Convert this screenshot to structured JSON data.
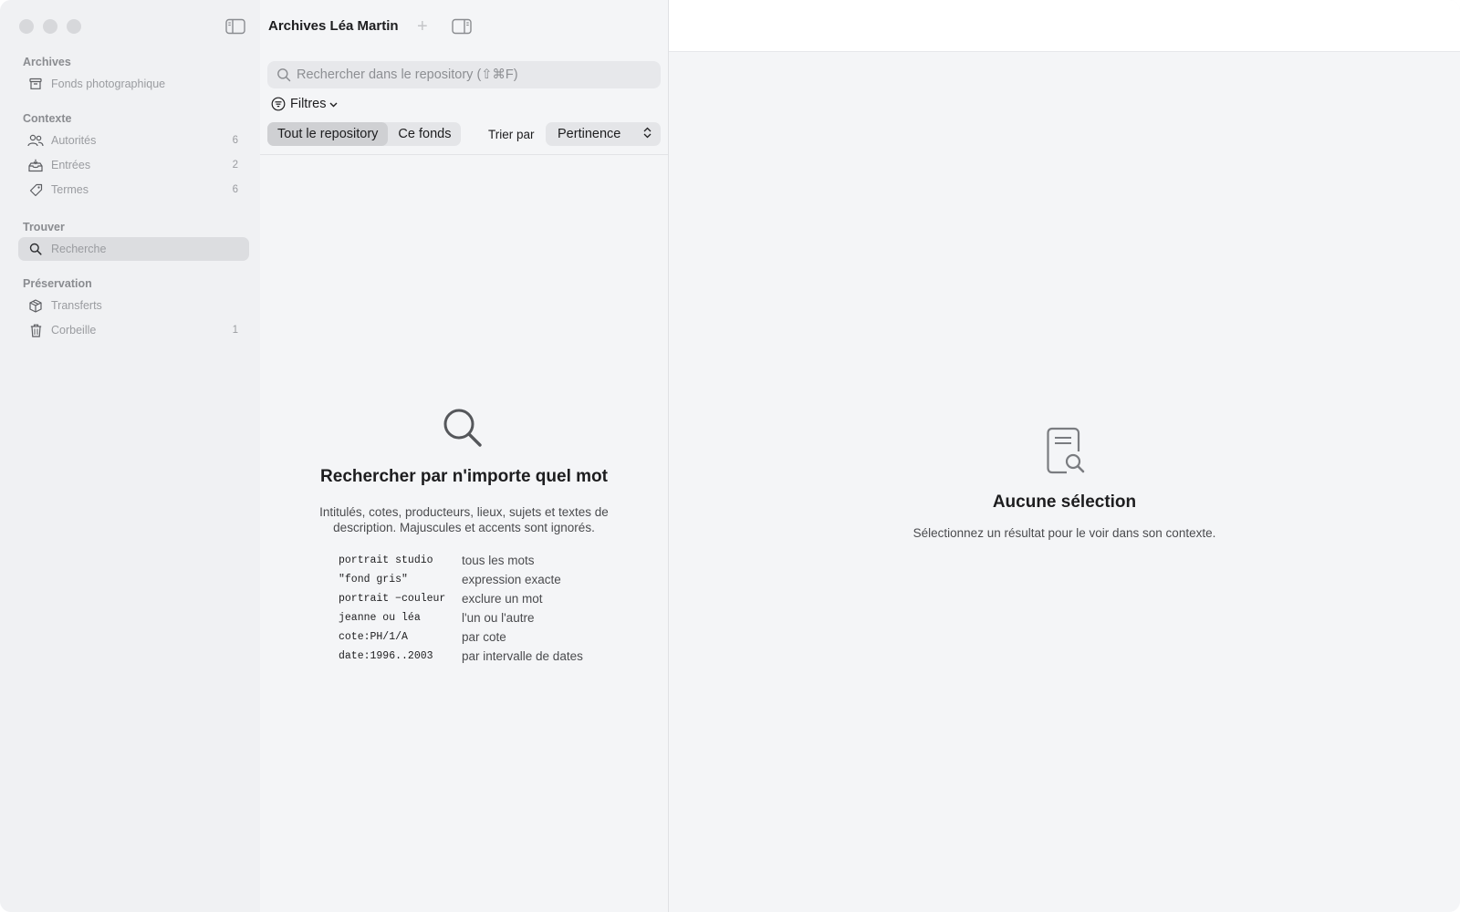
{
  "sidebar": {
    "sections": [
      {
        "title": "Archives",
        "items": [
          {
            "label": "Fonds photographique",
            "count": "",
            "icon": "archive-box-icon"
          }
        ]
      },
      {
        "title": "Contexte",
        "items": [
          {
            "label": "Autorités",
            "count": "6",
            "icon": "people-icon"
          },
          {
            "label": "Entrées",
            "count": "2",
            "icon": "tray-icon"
          },
          {
            "label": "Termes",
            "count": "6",
            "icon": "tag-icon"
          }
        ]
      },
      {
        "title": "Trouver",
        "items": [
          {
            "label": "Recherche",
            "count": "",
            "icon": "search-icon"
          }
        ]
      },
      {
        "title": "Préservation",
        "items": [
          {
            "label": "Transferts",
            "count": "",
            "icon": "package-icon"
          },
          {
            "label": "Corbeille",
            "count": "1",
            "icon": "trash-icon"
          }
        ]
      }
    ]
  },
  "header": {
    "title": "Archives Léa Martin"
  },
  "search": {
    "placeholder": "Rechercher dans le repository (⇧⌘F)",
    "value": ""
  },
  "filters": {
    "label": "Filtres"
  },
  "scope": {
    "options": [
      "Tout le repository",
      "Ce fonds"
    ],
    "selected": "Tout le repository"
  },
  "sort": {
    "label": "Trier par",
    "value": "Pertinence"
  },
  "empty_state": {
    "title": "Rechercher par n'importe quel mot",
    "description": "Intitulés, cotes, producteurs, lieux, sujets et textes de description. Majuscules et accents sont ignorés.",
    "tips": [
      {
        "code": "portrait studio",
        "desc": "tous les mots"
      },
      {
        "code": "\"fond gris\"",
        "desc": "expression exacte"
      },
      {
        "code": "portrait −couleur",
        "desc": "exclure un mot"
      },
      {
        "code": "jeanne ou léa",
        "desc": "l'un ou l'autre"
      },
      {
        "code": "cote:PH/1/A",
        "desc": "par cote"
      },
      {
        "code": "date:1996..2003",
        "desc": "par intervalle de dates"
      }
    ]
  },
  "detail": {
    "title": "Aucune sélection",
    "description": "Sélectionnez un résultat pour le voir dans son contexte."
  },
  "colors": {
    "sidebar_bg": "#f0f1f3",
    "content_bg": "#f4f5f7",
    "active_item": "#dcdde0",
    "muted_text": "#9a9ca0"
  }
}
